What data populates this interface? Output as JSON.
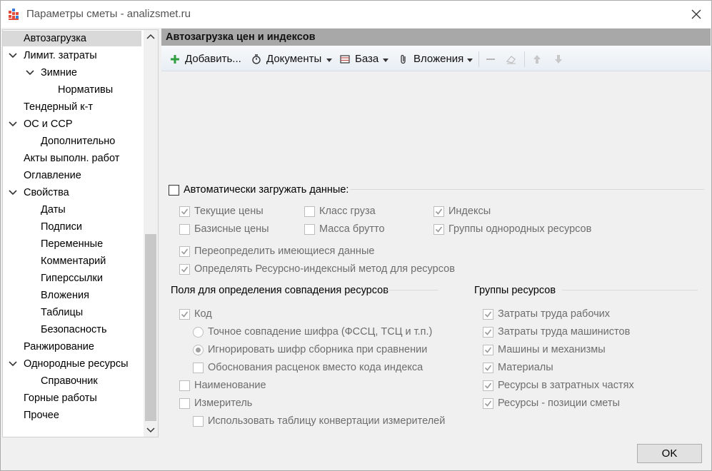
{
  "window": {
    "title": "Параметры сметы - analizsmet.ru"
  },
  "tree": {
    "items": [
      {
        "label": "Автозагрузка",
        "selected": true
      },
      {
        "label": "Лимит. затраты",
        "expanded": true
      },
      {
        "label": "Зимние",
        "expanded": true
      },
      {
        "label": "Нормативы"
      },
      {
        "label": "Тендерный к-т"
      },
      {
        "label": "ОС и ССР",
        "expanded": true
      },
      {
        "label": "Дополнительно"
      },
      {
        "label": "Акты выполн. работ"
      },
      {
        "label": "Оглавление"
      },
      {
        "label": "Свойства",
        "expanded": true
      },
      {
        "label": "Даты"
      },
      {
        "label": "Подписи"
      },
      {
        "label": "Переменные"
      },
      {
        "label": "Комментарий"
      },
      {
        "label": "Гиперссылки"
      },
      {
        "label": "Вложения"
      },
      {
        "label": "Таблицы"
      },
      {
        "label": "Безопасность"
      },
      {
        "label": "Ранжирование"
      },
      {
        "label": "Однородные ресурсы",
        "expanded": true
      },
      {
        "label": "Справочник"
      },
      {
        "label": "Горные работы"
      },
      {
        "label": "Прочее"
      }
    ]
  },
  "panel": {
    "header": "Автозагрузка цен и индексов",
    "toolbar": {
      "add": "Добавить...",
      "documents": "Документы",
      "base": "База",
      "attachments": "Вложения"
    },
    "auto_load": {
      "label": "Автоматически загружать данные:",
      "checked": false
    },
    "options": {
      "current_prices": {
        "label": "Текущие цены",
        "checked": true
      },
      "base_prices": {
        "label": "Базисные цены",
        "checked": false
      },
      "cargo_class": {
        "label": "Класс груза",
        "checked": false
      },
      "gross_mass": {
        "label": "Масса брутто",
        "checked": false
      },
      "indices": {
        "label": "Индексы",
        "checked": true
      },
      "resource_groups": {
        "label": "Группы однородных ресурсов",
        "checked": true
      },
      "override": {
        "label": "Переопределить имеющиеся данные",
        "checked": true
      },
      "resource_index_method": {
        "label": "Определять Ресурсно-индексный метод для ресурсов",
        "checked": true
      }
    },
    "match_fields": {
      "title": "Поля для определения совпадения ресурсов",
      "code": {
        "label": "Код",
        "checked": true
      },
      "exact_match": {
        "label": "Точное совпадение шифра (ФССЦ, ТСЦ и т.п.)",
        "selected": false
      },
      "ignore_code": {
        "label": "Игнорировать шифр сборника при сравнении",
        "selected": true
      },
      "justification": {
        "label": "Обоснования расценок вместо кода индекса",
        "checked": false
      },
      "name": {
        "label": "Наименование",
        "checked": false
      },
      "unit": {
        "label": "Измеритель",
        "checked": false
      },
      "conversion_table": {
        "label": "Использовать таблицу конвертации измерителей",
        "checked": false
      }
    },
    "resource_groups": {
      "title": "Группы ресурсов",
      "items": [
        {
          "label": "Затраты труда рабочих",
          "checked": true
        },
        {
          "label": "Затраты труда машинистов",
          "checked": true
        },
        {
          "label": "Машины и механизмы",
          "checked": true
        },
        {
          "label": "Материалы",
          "checked": true
        },
        {
          "label": "Ресурсы в затратных частях",
          "checked": true
        },
        {
          "label": "Ресурсы - позиции сметы",
          "checked": true
        }
      ]
    }
  },
  "footer": {
    "ok": "OK"
  },
  "colors": {
    "header_bg": "#a8a8a8",
    "selection_bg": "#d9d9d9",
    "add_icon": "#2e9e3e"
  }
}
